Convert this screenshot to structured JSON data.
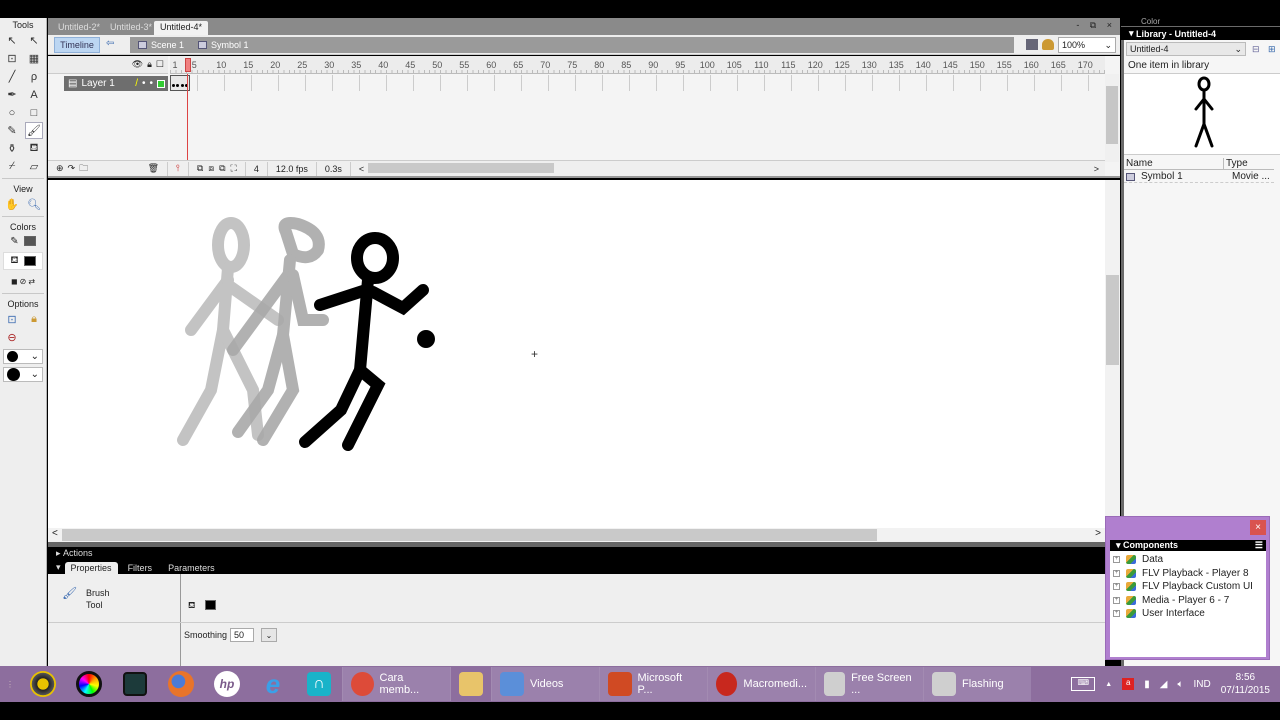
{
  "tools_panel": {
    "title": "Tools",
    "tools": [
      {
        "name": "selection",
        "glyph": "↖"
      },
      {
        "name": "subselection",
        "glyph": "↖"
      },
      {
        "name": "free-transform",
        "glyph": "⊡"
      },
      {
        "name": "fill-transform",
        "glyph": "▦"
      },
      {
        "name": "line",
        "glyph": "╱"
      },
      {
        "name": "lasso",
        "glyph": "ρ"
      },
      {
        "name": "pen",
        "glyph": "✒"
      },
      {
        "name": "text",
        "glyph": "A"
      },
      {
        "name": "oval",
        "glyph": "○"
      },
      {
        "name": "rectangle",
        "glyph": "□"
      },
      {
        "name": "pencil",
        "glyph": "✎"
      },
      {
        "name": "brush",
        "glyph": "🖌"
      },
      {
        "name": "ink-bottle",
        "glyph": "⚱"
      },
      {
        "name": "paint-bucket",
        "glyph": "⛾"
      },
      {
        "name": "eyedropper",
        "glyph": "⌿"
      },
      {
        "name": "eraser",
        "glyph": "▱"
      }
    ],
    "view_label": "View",
    "colors_label": "Colors",
    "options_label": "Options",
    "stroke_color": "#555555",
    "fill_color": "#000000"
  },
  "doc_tabs": [
    {
      "label": "Untitled-2*",
      "active": false
    },
    {
      "label": "Untitled-3*",
      "active": false
    },
    {
      "label": "Untitled-4*",
      "active": true
    }
  ],
  "window_controls": "- ⧉ ×",
  "edit_bar": {
    "timeline_button": "Timeline",
    "back_icon": "⇦",
    "breadcrumbs": [
      "Scene 1",
      "Symbol 1"
    ],
    "zoom": "100%"
  },
  "timeline": {
    "layers": [
      {
        "name": "Layer 1",
        "pencil": "/",
        "dot1": "•",
        "dot2": "•"
      }
    ],
    "ruler_start": "1",
    "ruler_ticks": [
      "5",
      "10",
      "15",
      "20",
      "25",
      "30",
      "35",
      "40",
      "45",
      "50",
      "55",
      "60",
      "65",
      "70",
      "75",
      "80",
      "85",
      "90",
      "95",
      "100",
      "105",
      "110",
      "115",
      "120",
      "125",
      "130",
      "135",
      "140",
      "145",
      "150",
      "155",
      "160",
      "165",
      "170"
    ],
    "current_frame": "4",
    "fps": "12.0 fps",
    "elapsed": "0.3s",
    "status_arrow": "<",
    "scroll_right": ">"
  },
  "stage": {
    "scroll_left": "<",
    "scroll_right": ">",
    "crosshair": "+"
  },
  "panels": {
    "actions_label": "Actions",
    "props_tabs": [
      "Properties",
      "Filters",
      "Parameters"
    ],
    "tool_name_line1": "Brush",
    "tool_name_line2": "Tool",
    "smoothing_label": "Smoothing",
    "smoothing_value": "50"
  },
  "library": {
    "color_label": "Color",
    "title": "Library - Untitled-4",
    "doc_select": "Untitled-4",
    "count_text": "One item in library",
    "col_name": "Name",
    "col_type": "Type",
    "items": [
      {
        "name": "Symbol 1",
        "type": "Movie ..."
      }
    ]
  },
  "components": {
    "title": "Components",
    "close": "×",
    "items": [
      "Data",
      "FLV Playback - Player 8",
      "FLV Playback Custom UI",
      "Media - Player 6 - 7",
      "User Interface"
    ]
  },
  "taskbar": {
    "pinned": [
      "webcam",
      "color-wheel",
      "video-camera",
      "firefox",
      "hp",
      "internet-explorer",
      "headphones"
    ],
    "apps": [
      {
        "label": "Cara memb...",
        "icon": "chrome",
        "color": "#dd4b39"
      },
      {
        "label": "",
        "icon": "paint",
        "color": "#e8c46a"
      },
      {
        "label": "Videos",
        "icon": "videos",
        "color": "#5b8fd9"
      },
      {
        "label": "Microsoft P...",
        "icon": "powerpoint",
        "color": "#d04a23"
      },
      {
        "label": "Macromedi...",
        "icon": "flash",
        "color": "#c8281e"
      },
      {
        "label": "Free Screen ...",
        "icon": "camera",
        "color": "#cfcfcf"
      },
      {
        "label": "Flashing",
        "icon": "camera",
        "color": "#cfcfcf"
      }
    ],
    "language": "IND",
    "time": "8:56",
    "date": "07/11/2015",
    "tray_up": "▲"
  }
}
